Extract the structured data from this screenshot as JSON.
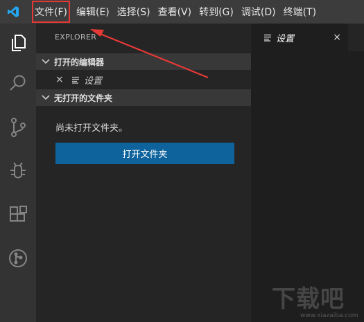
{
  "colors": {
    "accent": "#0e639c",
    "highlight": "#e53935",
    "logo": "#23a9f2"
  },
  "menubar": {
    "logo_icon": "vscode-logo-icon",
    "items": [
      {
        "label": "文件(F)"
      },
      {
        "label": "编辑(E)"
      },
      {
        "label": "选择(S)"
      },
      {
        "label": "查看(V)"
      },
      {
        "label": "转到(G)"
      },
      {
        "label": "调试(D)"
      },
      {
        "label": "终端(T)"
      }
    ]
  },
  "activitybar": {
    "icons": [
      "files-icon",
      "search-icon",
      "source-control-icon",
      "debug-icon",
      "extensions-icon",
      "remote-icon"
    ]
  },
  "sidebar": {
    "title": "EXPLORER",
    "sections": {
      "open_editors": "打开的编辑器",
      "no_folder": "无打开的文件夹"
    },
    "open_editor_item": {
      "close_glyph": "×",
      "label": "设置"
    },
    "empty_message": "尚未打开文件夹。",
    "open_folder_button": "打开文件夹"
  },
  "editor": {
    "tab": {
      "label": "设置",
      "close_glyph": "×"
    }
  },
  "watermark": {
    "logo_text": "下载吧",
    "url": "www.xiazaiba.com"
  }
}
